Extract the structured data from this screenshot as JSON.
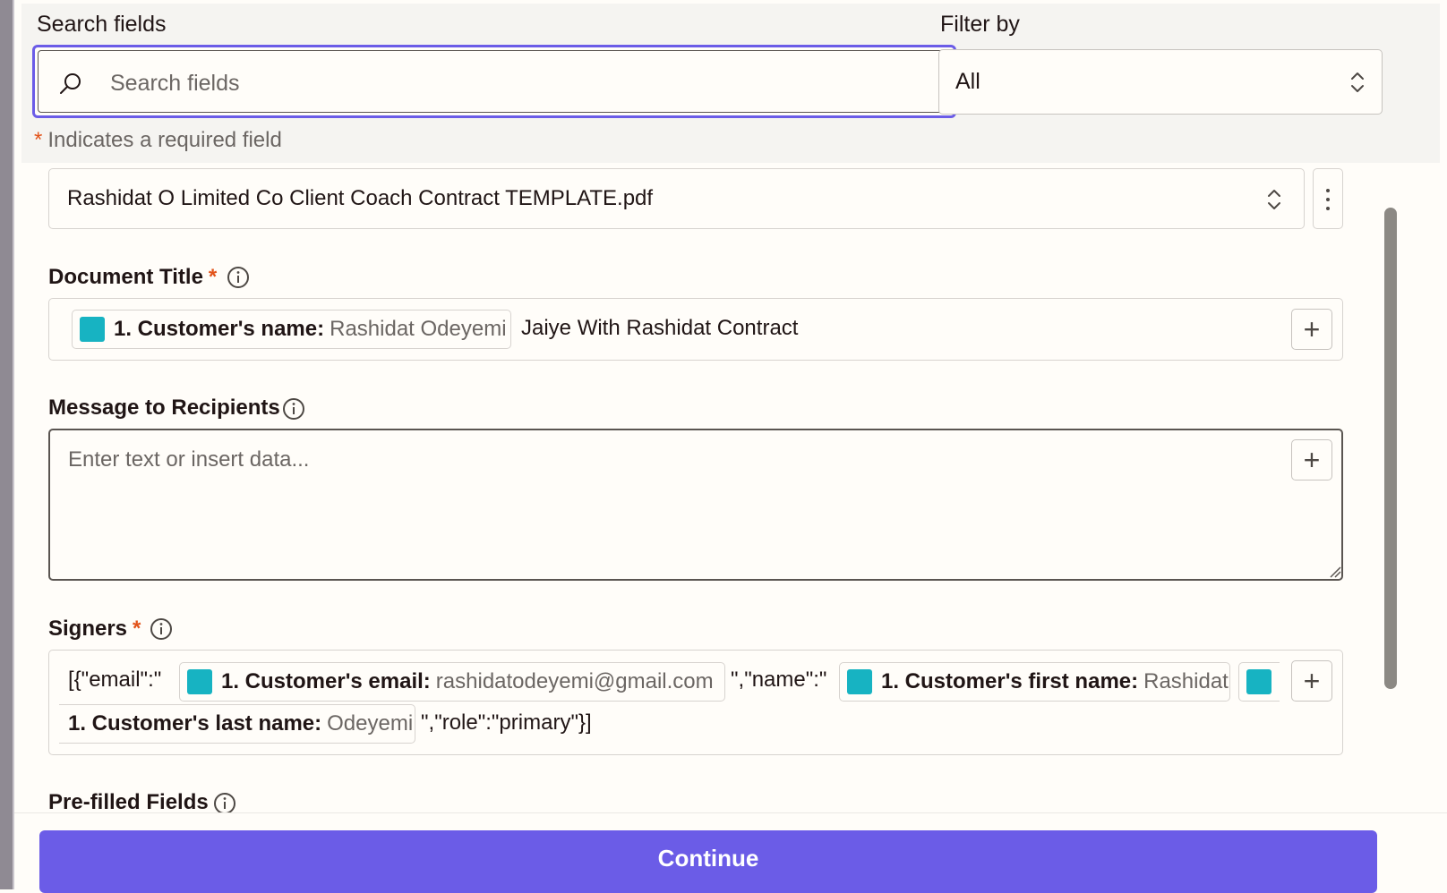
{
  "search": {
    "label": "Search fields",
    "placeholder": "Search fields"
  },
  "filter": {
    "label": "Filter by",
    "value": "All"
  },
  "required_note": {
    "star": "*",
    "text": "Indicates a required field"
  },
  "template_select": {
    "value": "Rashidat O Limited Co Client Coach Contract TEMPLATE.pdf"
  },
  "document_title": {
    "label": "Document Title",
    "required_star": "*",
    "pill_key": "1. Customer's name:",
    "pill_value": "Rashidat Odeyemi",
    "text": "Jaiye With Rashidat Contract"
  },
  "message": {
    "label": "Message to Recipients",
    "placeholder": "Enter text or insert data..."
  },
  "signers": {
    "label": "Signers",
    "required_star": "*",
    "text1": "[{\"email\":\"",
    "pill1_key": "1. Customer's email:",
    "pill1_value": "rashidatodeyemi@gmail.com",
    "text2": "\",\"name\":\"",
    "pill2_key": "1. Customer's first name:",
    "pill2_value": "Rashidat",
    "pill3_key": "1. Customer's last name:",
    "pill3_value": "Odeyemi",
    "text3": "\",\"role\":\"primary\"}]"
  },
  "prefilled": {
    "label": "Pre-filled Fields"
  },
  "footer": {
    "continue_label": "Continue"
  },
  "colors": {
    "accent": "#6b5ce7",
    "required": "#e2531a",
    "app_icon": "#17b3c2"
  },
  "icons": [
    "search-icon",
    "updown-chevron-icon",
    "kebab-menu-icon",
    "info-icon",
    "plus-icon",
    "app-icon"
  ]
}
